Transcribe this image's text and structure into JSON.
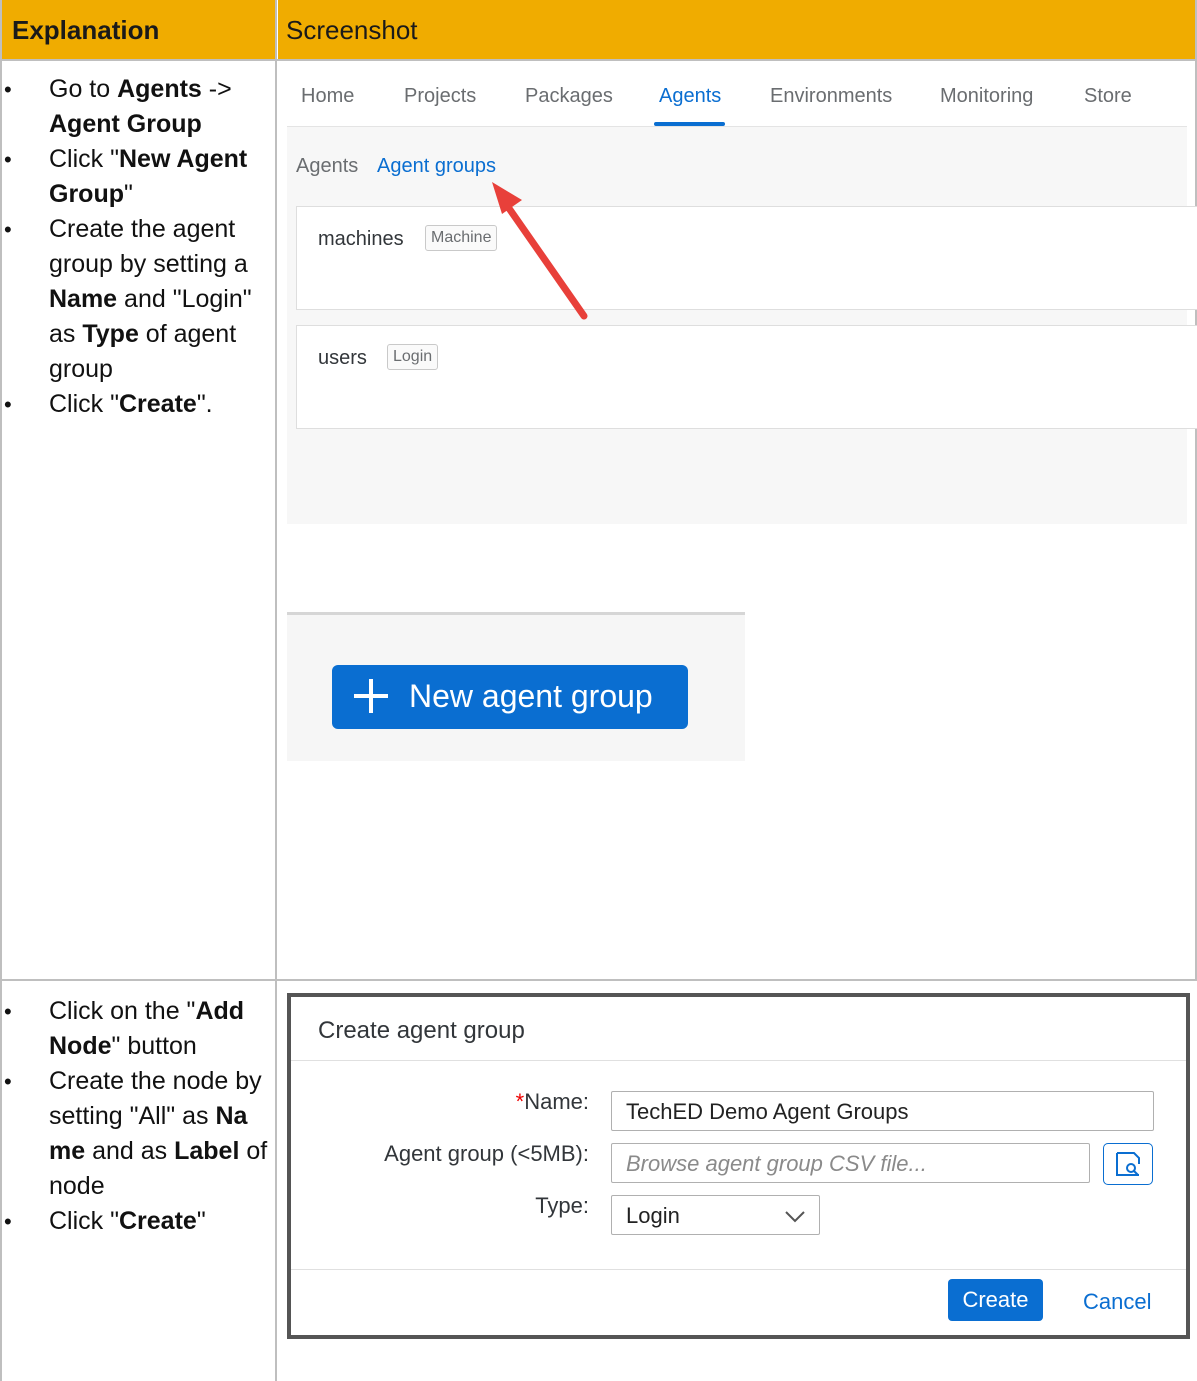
{
  "header": {
    "col1": "Explanation",
    "col2": "Screenshot"
  },
  "row1": {
    "steps": [
      {
        "parts": [
          {
            "t": "Go to "
          },
          {
            "t": "Agents",
            "b": true
          },
          {
            "t": " -> "
          },
          {
            "t": "Agent Group",
            "b": true
          }
        ]
      },
      {
        "parts": [
          {
            "t": "Click \""
          },
          {
            "t": "New Agent Group",
            "b": true
          },
          {
            "t": "\""
          }
        ]
      },
      {
        "parts": [
          {
            "t": "Create the agent group by setting a "
          },
          {
            "t": "Name",
            "b": true
          },
          {
            "t": " and \"Login\" as "
          },
          {
            "t": "Type",
            "b": true
          },
          {
            "t": " of agent group"
          }
        ]
      },
      {
        "parts": [
          {
            "t": "Click \""
          },
          {
            "t": "Create",
            "b": true
          },
          {
            "t": "\"."
          }
        ]
      }
    ],
    "nav": {
      "items": [
        "Home",
        "Projects",
        "Packages",
        "Agents",
        "Environments",
        "Monitoring",
        "Store"
      ],
      "active": "Agents"
    },
    "subnav": {
      "agents": "Agents",
      "agent_groups": "Agent groups"
    },
    "cards": [
      {
        "name": "machines",
        "tag": "Machine"
      },
      {
        "name": "users",
        "tag": "Login"
      }
    ],
    "new_button": "New agent group"
  },
  "row2": {
    "steps": [
      {
        "parts": [
          {
            "t": "Click on the \""
          },
          {
            "t": "Add Node",
            "b": true
          },
          {
            "t": "\" button"
          }
        ]
      },
      {
        "parts": [
          {
            "t": "Create the node by setting \"All\" as "
          },
          {
            "t": "Na me",
            "b": true
          },
          {
            "t": " and as "
          },
          {
            "t": "Label",
            "b": true
          },
          {
            "t": " of node"
          }
        ]
      },
      {
        "parts": [
          {
            "t": "Click \""
          },
          {
            "t": "Create",
            "b": true
          },
          {
            "t": "\""
          }
        ]
      }
    ],
    "dialog": {
      "title": "Create agent group",
      "name_required": "*",
      "name_label": "Name:",
      "name_value": "TechED Demo Agent Groups",
      "file_label": "Agent group (<5MB):",
      "file_placeholder": "Browse agent group CSV file...",
      "type_label": "Type:",
      "type_value": "Login",
      "create": "Create",
      "cancel": "Cancel"
    }
  },
  "colors": {
    "header": "#f0ac00",
    "accent": "#0a6ed1",
    "arrow": "#e8403a"
  }
}
